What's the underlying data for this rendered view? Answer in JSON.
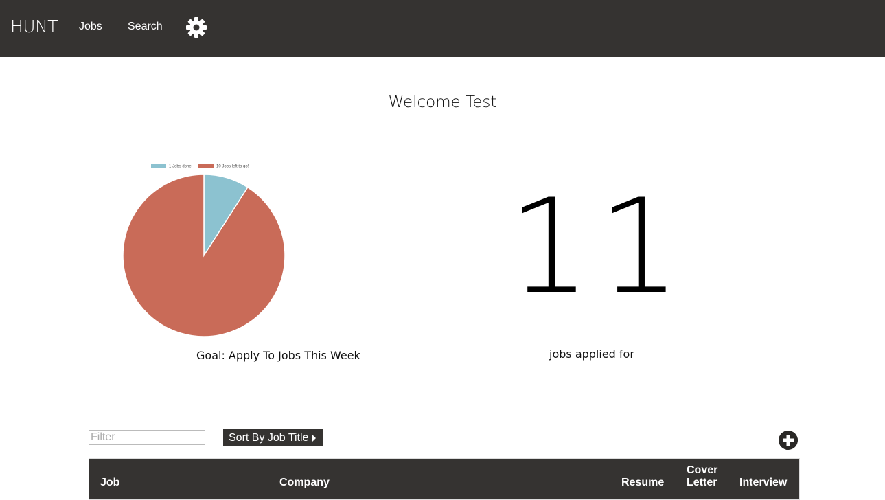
{
  "navbar": {
    "brand": "HUNT",
    "links": [
      "Jobs",
      "Search"
    ],
    "settings_icon": "gear-icon"
  },
  "welcome": "Welcome Test",
  "goal": {
    "caption": "Goal: Apply To Jobs This Week",
    "legend": [
      "1 Jobs done",
      "10 Jobs left to go!"
    ]
  },
  "chart_data": {
    "type": "pie",
    "categories": [
      "1 Jobs done",
      "10 Jobs left to go!"
    ],
    "values": [
      1,
      10
    ],
    "colors": [
      "#8cc2d0",
      "#c96b58"
    ],
    "legend": "top"
  },
  "stats": {
    "count": "11",
    "caption": "jobs applied for"
  },
  "controls": {
    "filter_placeholder": "Filter",
    "sort_label": "Sort By Job Title",
    "add_icon": "plus-circle-icon"
  },
  "table": {
    "columns": [
      "Job",
      "Company",
      "Resume",
      "Cover Letter",
      "Interview"
    ]
  }
}
